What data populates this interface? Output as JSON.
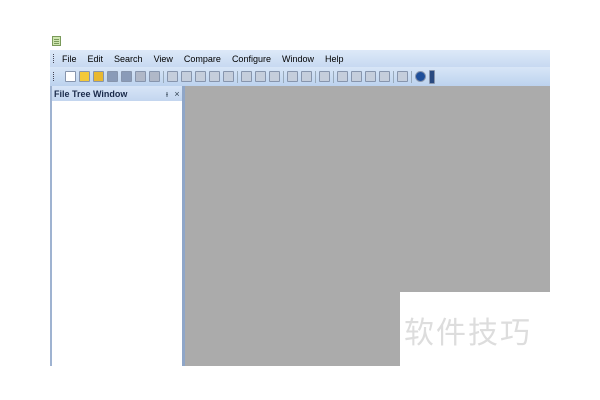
{
  "menu": [
    "File",
    "Edit",
    "Search",
    "View",
    "Compare",
    "Configure",
    "Window",
    "Help"
  ],
  "toolbar": {
    "icons": [
      "new-icon",
      "open-folder-icon",
      "open-project-icon",
      "save-icon",
      "save-all-icon",
      "close-icon",
      "close-all-icon",
      "undo-icon",
      "redo-icon",
      "cut-icon",
      "copy-icon",
      "paste-icon",
      "find-icon",
      "replace-icon",
      "sort-icon",
      "next-diff-icon",
      "prev-diff-icon",
      "compare-icon",
      "merge-icon",
      "merge-all-icon",
      "merge-right-icon",
      "filter-icon",
      "binary-icon",
      "help-icon",
      "overflow-icon"
    ]
  },
  "file_tree": {
    "title": "File Tree Window",
    "pin": "ᵼ",
    "close": "×"
  },
  "watermark": "软件技巧"
}
